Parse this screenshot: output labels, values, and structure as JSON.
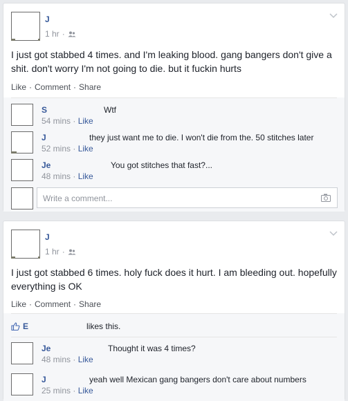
{
  "posts": [
    {
      "author": "J",
      "time": "1 hr",
      "text": "I just got stabbed 4 times. and I'm leaking blood. gang bangers don't give a shit. don't worry I'm not going to die. but it fuckin hurts",
      "actions": {
        "like": "Like",
        "comment": "Comment",
        "share": "Share"
      },
      "comments": [
        {
          "name": "S",
          "text": "Wtf",
          "time": "54 mins",
          "like": "Like"
        },
        {
          "name": "J",
          "text": "they just want me to die. I won't die from the. 50 stitches later",
          "time": "52 mins",
          "like": "Like"
        },
        {
          "name": "Je",
          "text": "You got stitches that fast?...",
          "time": "48 mins",
          "like": "Like"
        }
      ],
      "write_placeholder": "Write a comment..."
    },
    {
      "author": "J",
      "time": "1 hr",
      "text": "I just got stabbed 6 times. holy fuck does it hurt. I am bleeding out. hopefully everything is OK",
      "actions": {
        "like": "Like",
        "comment": "Comment",
        "share": "Share"
      },
      "likes": {
        "name": "E",
        "suffix": "likes this."
      },
      "comments": [
        {
          "name": "Je",
          "text": "Thought it was 4 times?",
          "time": "48 mins",
          "like": "Like"
        },
        {
          "name": "J",
          "text": "yeah well Mexican gang bangers don't care about numbers",
          "time": "25 mins",
          "like": "Like"
        }
      ]
    }
  ],
  "separators": {
    "dot": "·"
  },
  "icons": {
    "chevron": "chevron-down-icon",
    "audience": "friends-icon",
    "camera": "camera-icon",
    "like": "thumbs-up-icon"
  },
  "colors": {
    "link": "#365899",
    "meta": "#90949c",
    "background": "#e9ebee"
  }
}
